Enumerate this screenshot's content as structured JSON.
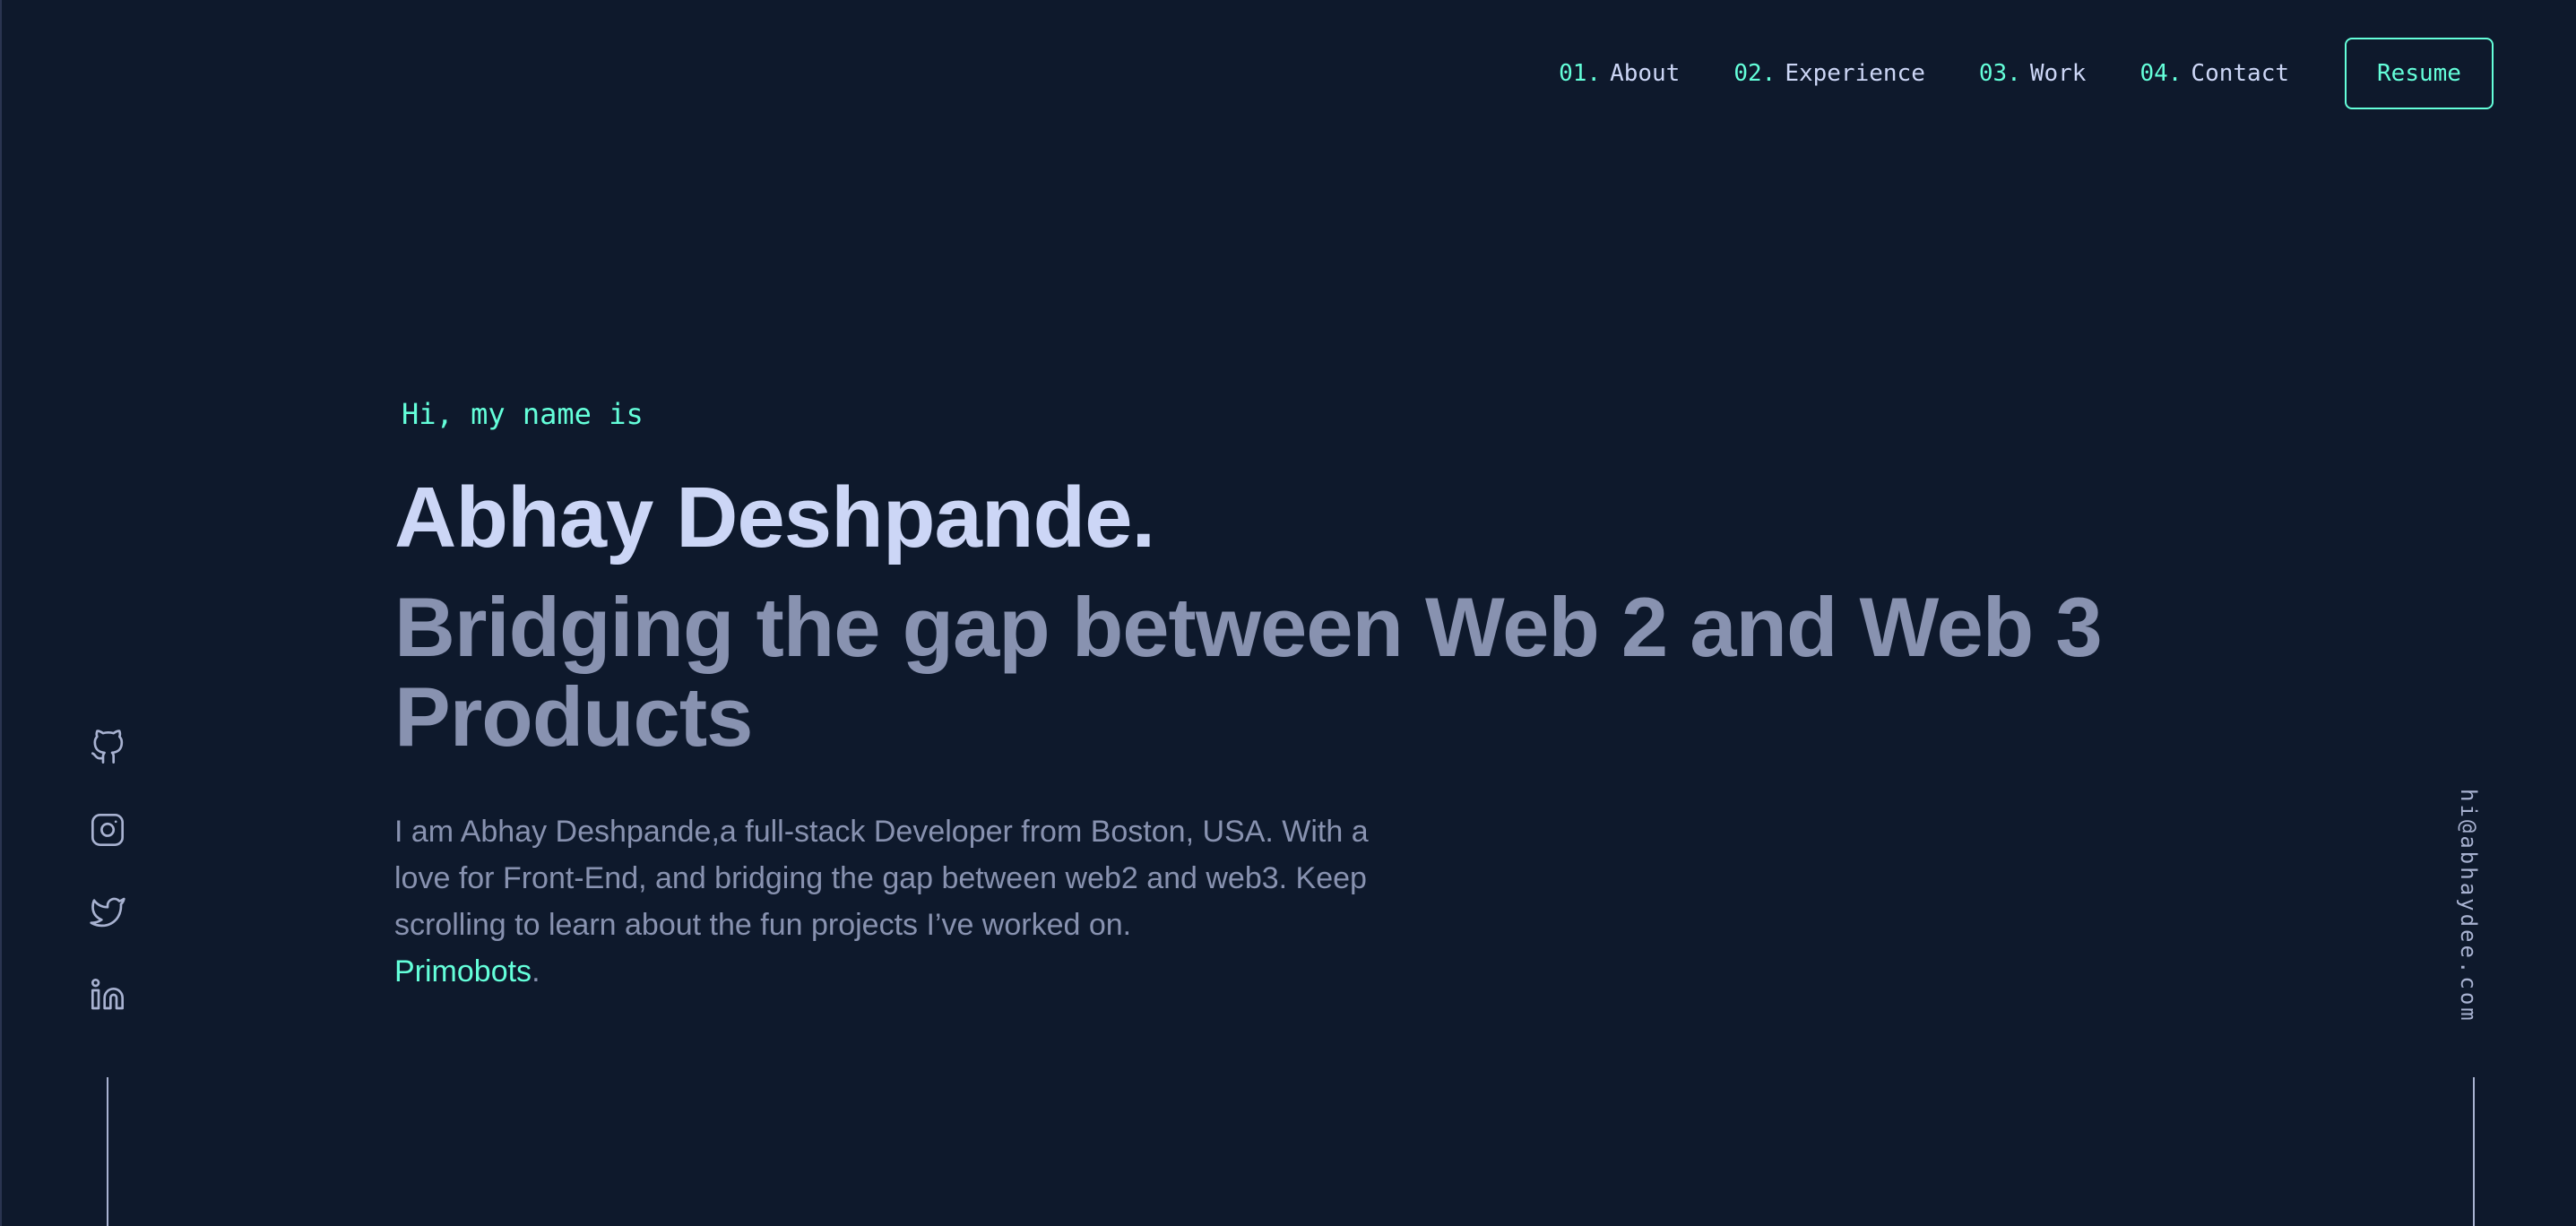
{
  "nav": {
    "items": [
      {
        "num": "01.",
        "label": "About"
      },
      {
        "num": "02.",
        "label": "Experience"
      },
      {
        "num": "03.",
        "label": "Work"
      },
      {
        "num": "04.",
        "label": "Contact"
      }
    ],
    "resume_label": "Resume"
  },
  "hero": {
    "greeting": "Hi, my name is",
    "name": "Abhay Deshpande.",
    "tagline": "Bridging the gap between Web 2 and Web 3 Products",
    "bio_text": "I am Abhay Deshpande,a full-stack Developer from Boston, USA. With a love for Front-End, and bridging the gap between web2 and web3. Keep scrolling to learn about the fun projects I’ve worked on.",
    "bio_link": "Primobots",
    "bio_end": "."
  },
  "social": {
    "icons": [
      "github-icon",
      "instagram-icon",
      "twitter-icon",
      "linkedin-icon"
    ]
  },
  "email": "hi@abhaydee.com",
  "colors": {
    "background": "#0e192c",
    "accent": "#64ffda",
    "heading": "#ccd6f6",
    "text": "#8892b0",
    "light": "#a8b2d1"
  }
}
